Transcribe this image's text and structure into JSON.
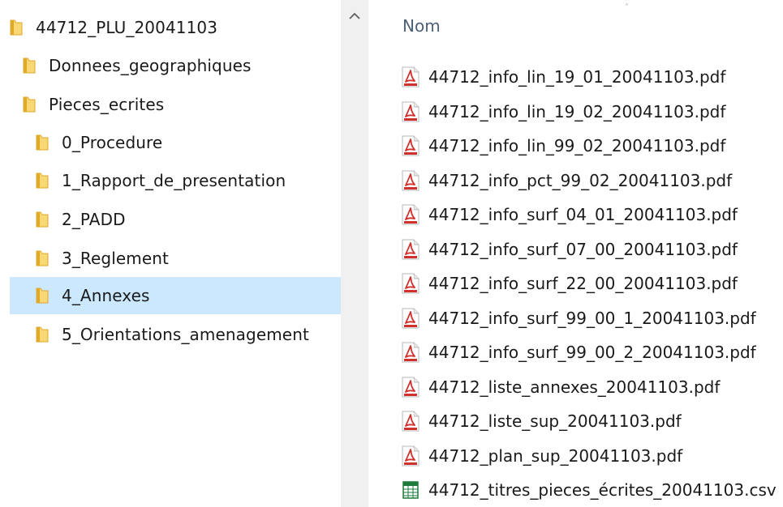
{
  "tree": {
    "items": [
      {
        "label": "44712_PLU_20041103",
        "selected": false
      },
      {
        "label": "Donnees_geographiques",
        "selected": false
      },
      {
        "label": "Pieces_ecrites",
        "selected": false
      },
      {
        "label": "0_Procedure",
        "selected": false
      },
      {
        "label": "1_Rapport_de_presentation",
        "selected": false
      },
      {
        "label": "2_PADD",
        "selected": false
      },
      {
        "label": "3_Reglement",
        "selected": false
      },
      {
        "label": "4_Annexes",
        "selected": true
      },
      {
        "label": "5_Orientations_amenagement",
        "selected": false
      }
    ]
  },
  "scrollbar": {
    "up_icon": "chevron-up-icon"
  },
  "content": {
    "column_name": "Nom",
    "files": [
      {
        "name": "44712_info_lin_19_01_20041103.pdf",
        "icon": "pdf-file-icon"
      },
      {
        "name": "44712_info_lin_19_02_20041103.pdf",
        "icon": "pdf-file-icon"
      },
      {
        "name": "44712_info_lin_99_02_20041103.pdf",
        "icon": "pdf-file-icon"
      },
      {
        "name": "44712_info_pct_99_02_20041103.pdf",
        "icon": "pdf-file-icon"
      },
      {
        "name": "44712_info_surf_04_01_20041103.pdf",
        "icon": "pdf-file-icon"
      },
      {
        "name": "44712_info_surf_07_00_20041103.pdf",
        "icon": "pdf-file-icon"
      },
      {
        "name": "44712_info_surf_22_00_20041103.pdf",
        "icon": "pdf-file-icon"
      },
      {
        "name": "44712_info_surf_99_00_1_20041103.pdf",
        "icon": "pdf-file-icon"
      },
      {
        "name": "44712_info_surf_99_00_2_20041103.pdf",
        "icon": "pdf-file-icon"
      },
      {
        "name": "44712_liste_annexes_20041103.pdf",
        "icon": "pdf-file-icon"
      },
      {
        "name": "44712_liste_sup_20041103.pdf",
        "icon": "pdf-file-icon"
      },
      {
        "name": "44712_plan_sup_20041103.pdf",
        "icon": "pdf-file-icon"
      },
      {
        "name": "44712_titres_pieces_écrites_20041103.csv",
        "icon": "csv-file-icon"
      }
    ]
  },
  "colors": {
    "selection": "#cce8ff",
    "folder": "#f8d775",
    "folder_dark": "#e0a92a",
    "pdf_red": "#d0312d",
    "csv_green": "#1e7a3c",
    "header_text": "#4c607a",
    "scrollbar_bg": "#f0f0f0"
  }
}
